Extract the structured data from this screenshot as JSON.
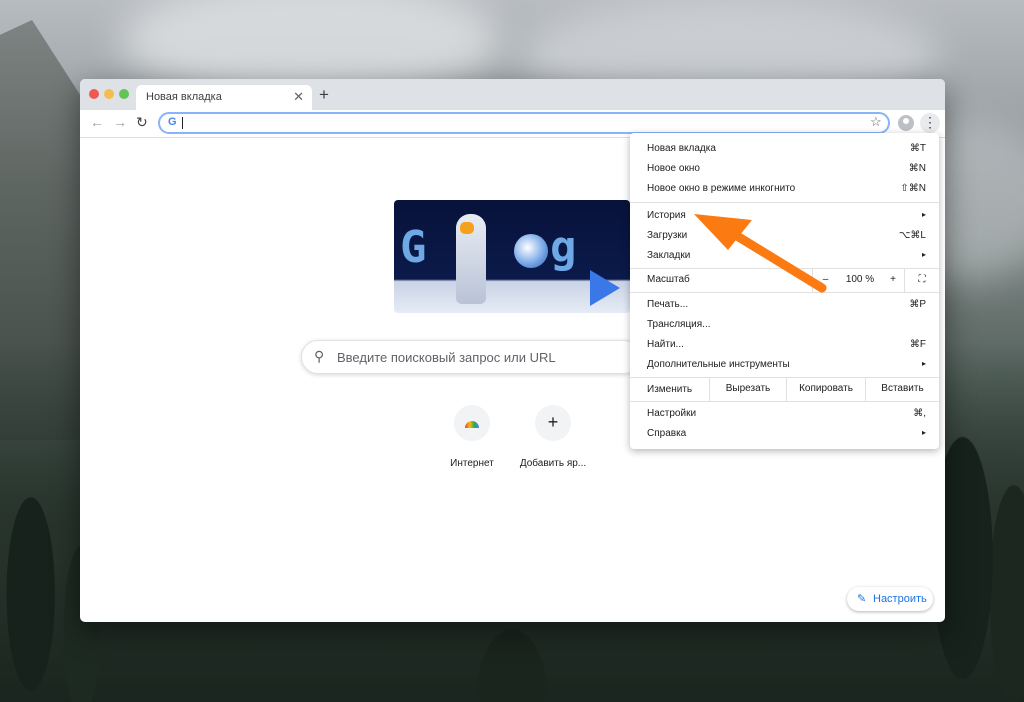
{
  "colors": {
    "accent_arrow": "#fb7a12",
    "traffic_close": "#ee5a52",
    "traffic_min": "#f5bd4f",
    "traffic_max": "#61c454",
    "link_blue": "#1a73e8"
  },
  "browser": {
    "tab": {
      "title": "Новая вкладка",
      "close_icon": "close-icon"
    },
    "new_tab_icon": "plus-icon",
    "toolbar": {
      "back_icon": "arrow-left-icon",
      "forward_icon": "arrow-right-icon",
      "reload_icon": "reload-icon",
      "omnibox_value": "",
      "bookmark_icon": "star-icon",
      "profile_icon": "avatar-icon",
      "menu_icon": "kebab-icon"
    }
  },
  "ntp": {
    "search_placeholder": "Введите поисковый запрос или URL",
    "shortcuts": [
      {
        "label": "Интернет",
        "icon": "rainbow-icon"
      },
      {
        "label": "Добавить яр...",
        "icon": "plus-icon"
      }
    ],
    "customize_label": "Настроить"
  },
  "menu": {
    "items": [
      {
        "label": "Новая вкладка",
        "shortcut": "⌘T"
      },
      {
        "label": "Новое окно",
        "shortcut": "⌘N"
      },
      {
        "label": "Новое окно в режиме инкогнито",
        "shortcut": "⇧⌘N"
      },
      {
        "label": "История",
        "shortcut": "▸"
      },
      {
        "label": "Загрузки",
        "shortcut": "⌥⌘L"
      },
      {
        "label": "Закладки",
        "shortcut": "▸"
      }
    ],
    "zoom": {
      "label": "Масштаб",
      "minus": "–",
      "value": "100 %",
      "plus": "+",
      "fullscreen": "⛶"
    },
    "items2": [
      {
        "label": "Печать...",
        "shortcut": "⌘P"
      },
      {
        "label": "Трансляция...",
        "shortcut": ""
      },
      {
        "label": "Найти...",
        "shortcut": "⌘F"
      },
      {
        "label": "Дополнительные инструменты",
        "shortcut": "▸"
      }
    ],
    "edit": {
      "label": "Изменить",
      "cut": "Вырезать",
      "copy": "Копировать",
      "paste": "Вставить"
    },
    "items3": [
      {
        "label": "Настройки",
        "shortcut": "⌘,"
      },
      {
        "label": "Справка",
        "shortcut": "▸"
      }
    ]
  }
}
